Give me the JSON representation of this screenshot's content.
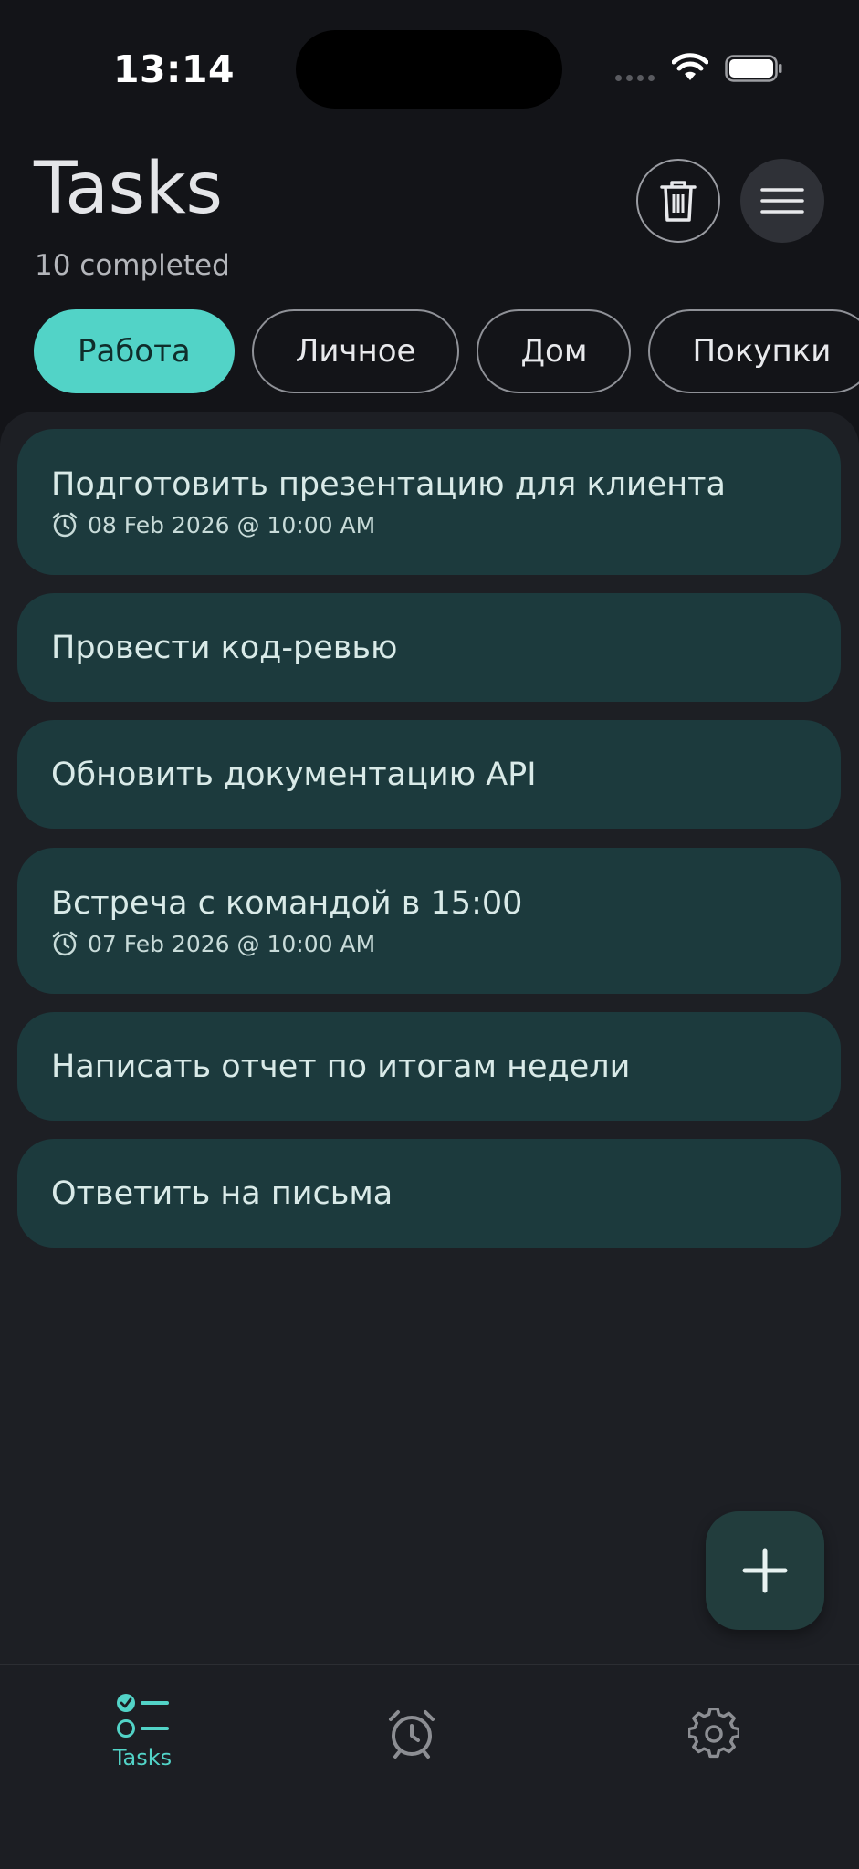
{
  "status_bar": {
    "time": "13:14"
  },
  "header": {
    "title": "Tasks",
    "subtitle": "10 completed"
  },
  "chips": [
    {
      "label": "Работа",
      "active": true
    },
    {
      "label": "Личное",
      "active": false
    },
    {
      "label": "Дом",
      "active": false
    },
    {
      "label": "Покупки",
      "active": false
    }
  ],
  "tasks": [
    {
      "title": "Подготовить презентацию для клиента",
      "due": "08 Feb 2026 @ 10:00 AM"
    },
    {
      "title": "Провести код-ревью",
      "due": null
    },
    {
      "title": "Обновить документацию API",
      "due": null
    },
    {
      "title": "Встреча с командой в 15:00",
      "due": "07 Feb 2026 @ 10:00 AM"
    },
    {
      "title": "Написать отчет по итогам недели",
      "due": null
    },
    {
      "title": "Ответить на письма",
      "due": null
    }
  ],
  "bottom_nav": [
    {
      "label": "Tasks",
      "icon": "checklist-icon",
      "active": true
    },
    {
      "label": "",
      "icon": "alarm-icon",
      "active": false
    },
    {
      "label": "",
      "icon": "gear-icon",
      "active": false
    }
  ],
  "colors": {
    "accent": "#52d3c7",
    "card": "#1c3a3d",
    "background": "#131418",
    "panel": "#1d1f24"
  }
}
